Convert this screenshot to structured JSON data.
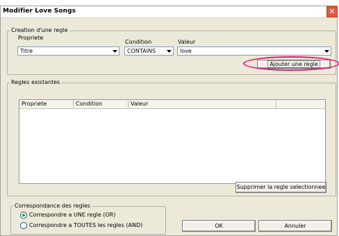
{
  "window": {
    "title": "Modifier Love Songs",
    "close_glyph": "✕"
  },
  "creation": {
    "legend": "Creation d'une regle",
    "property_label": "Propriete",
    "property_value": "Titre",
    "condition_label": "Condition",
    "condition_value": "CONTAINS",
    "value_label": "Valeur",
    "value_value": "love",
    "add_button": "Ajouter une regle"
  },
  "existing": {
    "legend": "Regles existantes",
    "columns": [
      "Propriete",
      "Condition",
      "Valeur"
    ],
    "rows": [],
    "delete_button": "Supprimer la regle selectionnee"
  },
  "matching": {
    "legend": "Correspondance des regles",
    "options": [
      {
        "label": "Correspondre a UNE regle (OR)",
        "selected": true
      },
      {
        "label": "Correspondre a TOUTES les regles (AND)",
        "selected": false
      }
    ]
  },
  "footer": {
    "ok_button": "OK",
    "cancel_button": "Annuler"
  },
  "colors": {
    "highlight": "#e0157a",
    "dialog_bg": "#ece9d8",
    "radio_dot": "#21a121"
  }
}
